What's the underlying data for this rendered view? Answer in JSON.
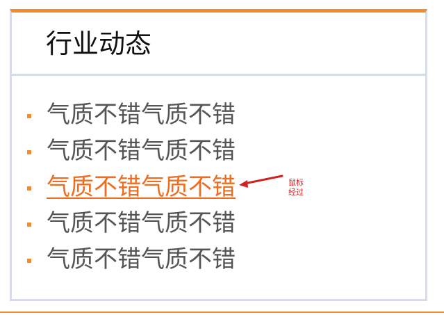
{
  "panel": {
    "title": "行业动态",
    "accent_color": "#f28c28",
    "border_color": "#d6dde8",
    "items": [
      {
        "label": "气质不错气质不错",
        "state": "normal"
      },
      {
        "label": "气质不错气质不错",
        "state": "normal"
      },
      {
        "label": "气质不错气质不错",
        "state": "hover"
      },
      {
        "label": "气质不错气质不错",
        "state": "normal"
      },
      {
        "label": "气质不错气质不错",
        "state": "normal"
      }
    ]
  },
  "annotation": {
    "text": "鼠标经过",
    "color": "#d21f1f",
    "icon": "red-arrow-icon"
  },
  "colors": {
    "link_text": "#555555",
    "link_hover": "#ef6d1f"
  }
}
